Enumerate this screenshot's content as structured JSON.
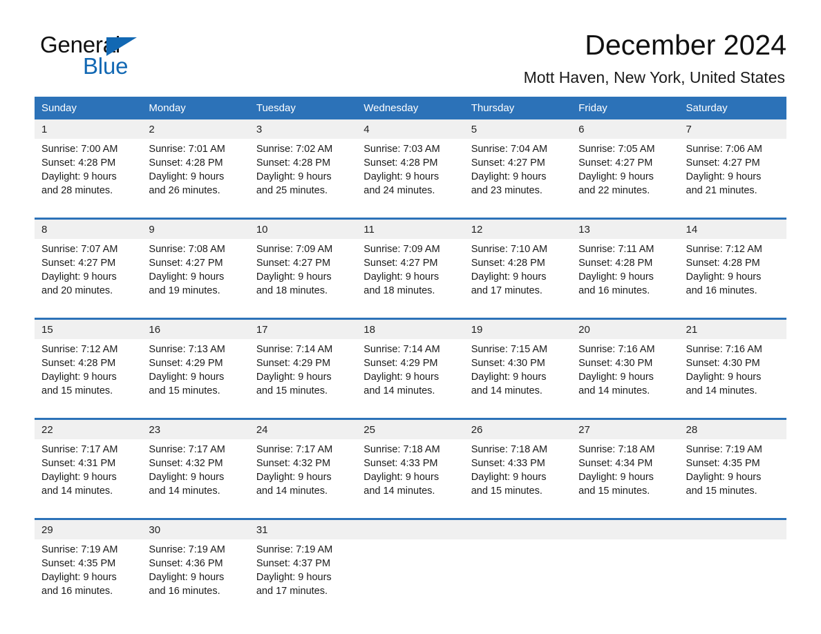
{
  "brand": {
    "name_part1": "General",
    "name_part2": "Blue",
    "accent_color": "#1268b3",
    "header_color": "#2c72b8"
  },
  "header": {
    "title": "December 2024",
    "location": "Mott Haven, New York, United States"
  },
  "calendar": {
    "weekdays": [
      "Sunday",
      "Monday",
      "Tuesday",
      "Wednesday",
      "Thursday",
      "Friday",
      "Saturday"
    ],
    "weeks": [
      [
        {
          "day": "1",
          "sunrise": "Sunrise: 7:00 AM",
          "sunset": "Sunset: 4:28 PM",
          "daylight_line1": "Daylight: 9 hours",
          "daylight_line2": "and 28 minutes."
        },
        {
          "day": "2",
          "sunrise": "Sunrise: 7:01 AM",
          "sunset": "Sunset: 4:28 PM",
          "daylight_line1": "Daylight: 9 hours",
          "daylight_line2": "and 26 minutes."
        },
        {
          "day": "3",
          "sunrise": "Sunrise: 7:02 AM",
          "sunset": "Sunset: 4:28 PM",
          "daylight_line1": "Daylight: 9 hours",
          "daylight_line2": "and 25 minutes."
        },
        {
          "day": "4",
          "sunrise": "Sunrise: 7:03 AM",
          "sunset": "Sunset: 4:28 PM",
          "daylight_line1": "Daylight: 9 hours",
          "daylight_line2": "and 24 minutes."
        },
        {
          "day": "5",
          "sunrise": "Sunrise: 7:04 AM",
          "sunset": "Sunset: 4:27 PM",
          "daylight_line1": "Daylight: 9 hours",
          "daylight_line2": "and 23 minutes."
        },
        {
          "day": "6",
          "sunrise": "Sunrise: 7:05 AM",
          "sunset": "Sunset: 4:27 PM",
          "daylight_line1": "Daylight: 9 hours",
          "daylight_line2": "and 22 minutes."
        },
        {
          "day": "7",
          "sunrise": "Sunrise: 7:06 AM",
          "sunset": "Sunset: 4:27 PM",
          "daylight_line1": "Daylight: 9 hours",
          "daylight_line2": "and 21 minutes."
        }
      ],
      [
        {
          "day": "8",
          "sunrise": "Sunrise: 7:07 AM",
          "sunset": "Sunset: 4:27 PM",
          "daylight_line1": "Daylight: 9 hours",
          "daylight_line2": "and 20 minutes."
        },
        {
          "day": "9",
          "sunrise": "Sunrise: 7:08 AM",
          "sunset": "Sunset: 4:27 PM",
          "daylight_line1": "Daylight: 9 hours",
          "daylight_line2": "and 19 minutes."
        },
        {
          "day": "10",
          "sunrise": "Sunrise: 7:09 AM",
          "sunset": "Sunset: 4:27 PM",
          "daylight_line1": "Daylight: 9 hours",
          "daylight_line2": "and 18 minutes."
        },
        {
          "day": "11",
          "sunrise": "Sunrise: 7:09 AM",
          "sunset": "Sunset: 4:27 PM",
          "daylight_line1": "Daylight: 9 hours",
          "daylight_line2": "and 18 minutes."
        },
        {
          "day": "12",
          "sunrise": "Sunrise: 7:10 AM",
          "sunset": "Sunset: 4:28 PM",
          "daylight_line1": "Daylight: 9 hours",
          "daylight_line2": "and 17 minutes."
        },
        {
          "day": "13",
          "sunrise": "Sunrise: 7:11 AM",
          "sunset": "Sunset: 4:28 PM",
          "daylight_line1": "Daylight: 9 hours",
          "daylight_line2": "and 16 minutes."
        },
        {
          "day": "14",
          "sunrise": "Sunrise: 7:12 AM",
          "sunset": "Sunset: 4:28 PM",
          "daylight_line1": "Daylight: 9 hours",
          "daylight_line2": "and 16 minutes."
        }
      ],
      [
        {
          "day": "15",
          "sunrise": "Sunrise: 7:12 AM",
          "sunset": "Sunset: 4:28 PM",
          "daylight_line1": "Daylight: 9 hours",
          "daylight_line2": "and 15 minutes."
        },
        {
          "day": "16",
          "sunrise": "Sunrise: 7:13 AM",
          "sunset": "Sunset: 4:29 PM",
          "daylight_line1": "Daylight: 9 hours",
          "daylight_line2": "and 15 minutes."
        },
        {
          "day": "17",
          "sunrise": "Sunrise: 7:14 AM",
          "sunset": "Sunset: 4:29 PM",
          "daylight_line1": "Daylight: 9 hours",
          "daylight_line2": "and 15 minutes."
        },
        {
          "day": "18",
          "sunrise": "Sunrise: 7:14 AM",
          "sunset": "Sunset: 4:29 PM",
          "daylight_line1": "Daylight: 9 hours",
          "daylight_line2": "and 14 minutes."
        },
        {
          "day": "19",
          "sunrise": "Sunrise: 7:15 AM",
          "sunset": "Sunset: 4:30 PM",
          "daylight_line1": "Daylight: 9 hours",
          "daylight_line2": "and 14 minutes."
        },
        {
          "day": "20",
          "sunrise": "Sunrise: 7:16 AM",
          "sunset": "Sunset: 4:30 PM",
          "daylight_line1": "Daylight: 9 hours",
          "daylight_line2": "and 14 minutes."
        },
        {
          "day": "21",
          "sunrise": "Sunrise: 7:16 AM",
          "sunset": "Sunset: 4:30 PM",
          "daylight_line1": "Daylight: 9 hours",
          "daylight_line2": "and 14 minutes."
        }
      ],
      [
        {
          "day": "22",
          "sunrise": "Sunrise: 7:17 AM",
          "sunset": "Sunset: 4:31 PM",
          "daylight_line1": "Daylight: 9 hours",
          "daylight_line2": "and 14 minutes."
        },
        {
          "day": "23",
          "sunrise": "Sunrise: 7:17 AM",
          "sunset": "Sunset: 4:32 PM",
          "daylight_line1": "Daylight: 9 hours",
          "daylight_line2": "and 14 minutes."
        },
        {
          "day": "24",
          "sunrise": "Sunrise: 7:17 AM",
          "sunset": "Sunset: 4:32 PM",
          "daylight_line1": "Daylight: 9 hours",
          "daylight_line2": "and 14 minutes."
        },
        {
          "day": "25",
          "sunrise": "Sunrise: 7:18 AM",
          "sunset": "Sunset: 4:33 PM",
          "daylight_line1": "Daylight: 9 hours",
          "daylight_line2": "and 14 minutes."
        },
        {
          "day": "26",
          "sunrise": "Sunrise: 7:18 AM",
          "sunset": "Sunset: 4:33 PM",
          "daylight_line1": "Daylight: 9 hours",
          "daylight_line2": "and 15 minutes."
        },
        {
          "day": "27",
          "sunrise": "Sunrise: 7:18 AM",
          "sunset": "Sunset: 4:34 PM",
          "daylight_line1": "Daylight: 9 hours",
          "daylight_line2": "and 15 minutes."
        },
        {
          "day": "28",
          "sunrise": "Sunrise: 7:19 AM",
          "sunset": "Sunset: 4:35 PM",
          "daylight_line1": "Daylight: 9 hours",
          "daylight_line2": "and 15 minutes."
        }
      ],
      [
        {
          "day": "29",
          "sunrise": "Sunrise: 7:19 AM",
          "sunset": "Sunset: 4:35 PM",
          "daylight_line1": "Daylight: 9 hours",
          "daylight_line2": "and 16 minutes."
        },
        {
          "day": "30",
          "sunrise": "Sunrise: 7:19 AM",
          "sunset": "Sunset: 4:36 PM",
          "daylight_line1": "Daylight: 9 hours",
          "daylight_line2": "and 16 minutes."
        },
        {
          "day": "31",
          "sunrise": "Sunrise: 7:19 AM",
          "sunset": "Sunset: 4:37 PM",
          "daylight_line1": "Daylight: 9 hours",
          "daylight_line2": "and 17 minutes."
        },
        {
          "day": "",
          "sunrise": "",
          "sunset": "",
          "daylight_line1": "",
          "daylight_line2": ""
        },
        {
          "day": "",
          "sunrise": "",
          "sunset": "",
          "daylight_line1": "",
          "daylight_line2": ""
        },
        {
          "day": "",
          "sunrise": "",
          "sunset": "",
          "daylight_line1": "",
          "daylight_line2": ""
        },
        {
          "day": "",
          "sunrise": "",
          "sunset": "",
          "daylight_line1": "",
          "daylight_line2": ""
        }
      ]
    ]
  }
}
